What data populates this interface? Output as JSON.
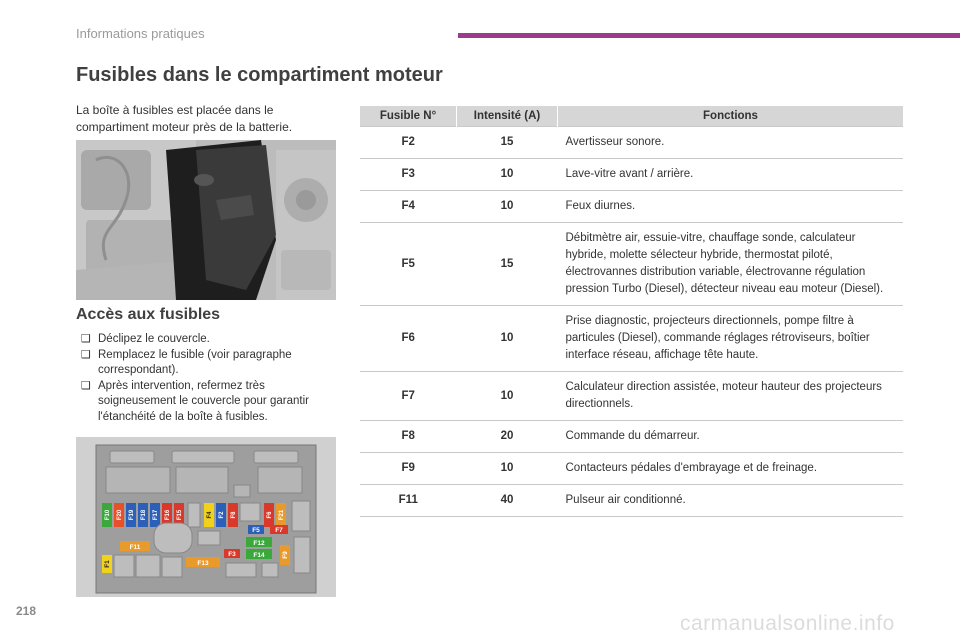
{
  "header": {
    "section": "Informations pratiques",
    "accent_color": "#9b3b8c"
  },
  "page_title": "Fusibles dans le compartiment moteur",
  "intro": "La boîte à fusibles est placée dans le compartiment moteur près de la batterie.",
  "access": {
    "title": "Accès aux fusibles",
    "bullet_icon": "checkbox-icon",
    "steps": [
      "Déclipez le couvercle.",
      "Remplacez le fusible (voir paragraphe correspondant).",
      "Après intervention, refermez très soigneusement le couvercle pour garantir l'étanchéité de la boîte à fusibles."
    ]
  },
  "fusebox_labels": {
    "row_top": [
      "F10",
      "F20",
      "F19",
      "F18",
      "F17",
      "F16",
      "F15",
      "F4",
      "F2",
      "F8",
      "F6",
      "F21"
    ],
    "f5": "F5",
    "f7": "F7",
    "f12": "F12",
    "f11": "F11",
    "f3": "F3",
    "f14": "F14",
    "f13": "F13",
    "f1": "F1",
    "f9": "F9"
  },
  "table": {
    "headers": [
      "Fusible N°",
      "Intensité (A)",
      "Fonctions"
    ],
    "rows": [
      {
        "fuse": "F2",
        "amp": "15",
        "func": "Avertisseur sonore."
      },
      {
        "fuse": "F3",
        "amp": "10",
        "func": "Lave-vitre avant / arrière."
      },
      {
        "fuse": "F4",
        "amp": "10",
        "func": "Feux diurnes."
      },
      {
        "fuse": "F5",
        "amp": "15",
        "func": "Débitmètre air, essuie-vitre, chauffage sonde, calculateur hybride, molette sélecteur hybride, thermostat piloté, électrovannes distribution variable, électrovanne régulation pression Turbo (Diesel), détecteur niveau eau moteur (Diesel)."
      },
      {
        "fuse": "F6",
        "amp": "10",
        "func": "Prise diagnostic, projecteurs directionnels, pompe filtre à particules (Diesel), commande réglages rétroviseurs, boîtier interface réseau, affichage tête haute."
      },
      {
        "fuse": "F7",
        "amp": "10",
        "func": "Calculateur direction assistée, moteur hauteur des projecteurs directionnels."
      },
      {
        "fuse": "F8",
        "amp": "20",
        "func": "Commande du démarreur."
      },
      {
        "fuse": "F9",
        "amp": "10",
        "func": "Contacteurs pédales d'embrayage et de freinage."
      },
      {
        "fuse": "F11",
        "amp": "40",
        "func": "Pulseur air conditionné."
      }
    ]
  },
  "page_number": "218",
  "watermark": "carmanualsonline.info"
}
